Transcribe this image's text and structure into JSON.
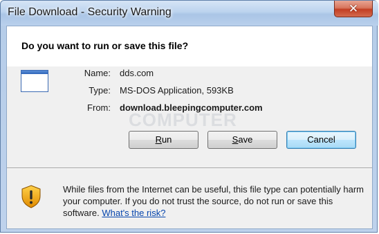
{
  "window": {
    "title": "File Download - Security Warning",
    "close_glyph": "✕"
  },
  "dialog": {
    "question": "Do you want to run or save this file?",
    "fields": [
      {
        "label": "Name:",
        "value": "dds.com"
      },
      {
        "label": "Type:",
        "value": "MS-DOS Application, 593KB"
      },
      {
        "label": "From:",
        "value": "download.bleepingcomputer.com"
      }
    ],
    "watermark": "COMPUTER",
    "buttons": {
      "run": {
        "mnemonic": "R",
        "rest": "un"
      },
      "save": {
        "mnemonic": "S",
        "rest": "ave"
      },
      "cancel": {
        "label": "Cancel"
      }
    },
    "warning": {
      "text": "While files from the Internet can be useful, this file type can potentially harm your computer. If you do not trust the source, do not run or save this software. ",
      "link": "What's the risk?"
    }
  },
  "colors": {
    "title_bar": "#b9d0ec",
    "close_button": "#c23e23",
    "link": "#0645ad",
    "default_button_border": "#3c7fb1"
  },
  "icons": {
    "close": "close-icon",
    "file": "application-file-icon",
    "warning": "shield-warning-icon"
  }
}
